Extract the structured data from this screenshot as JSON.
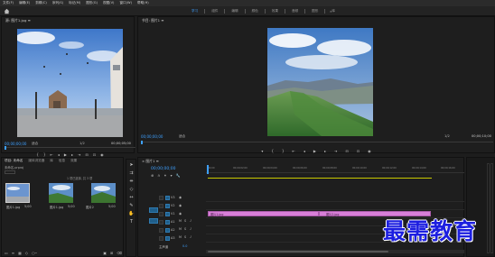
{
  "menu": {
    "items": [
      "文件(F)",
      "编辑(E)",
      "剪辑(C)",
      "序列(S)",
      "标记(M)",
      "图形(G)",
      "视图(V)",
      "窗口(W)",
      "帮助(H)"
    ]
  },
  "workspaces": {
    "tabs": [
      "学习",
      "组件",
      "编辑",
      "颜色",
      "效果",
      "音频",
      "图形",
      "库"
    ],
    "active_index": 0,
    "more_label": "»"
  },
  "source_monitor": {
    "title": "源: 图片1.jpg ≡",
    "timecode_in": "00;00;00;00",
    "fit_label": "适合",
    "fraction": "1/2",
    "timecode_out": "00;00;05;00"
  },
  "program_monitor": {
    "title": "节目: 图片1 ≡",
    "timecode_in": "00;00;00;00",
    "fit_label": "适合",
    "fraction": "1/2",
    "timecode_out": "00;00;10;00"
  },
  "project_panel": {
    "tabs": [
      "项目: 未命名",
      "媒体浏览器",
      "库",
      "信息",
      "效果"
    ],
    "active_tab": 0,
    "file_name": "未命名.prproj",
    "item_count": "1 项已选择, 共 3 项",
    "items": [
      {
        "label": "图片1.jpg",
        "duration": "5;00"
      },
      {
        "label": "图片1.jpg",
        "duration": "5;00"
      },
      {
        "label": "图片2",
        "duration": "5;00"
      }
    ]
  },
  "timeline": {
    "title": "× 图片1 ≡",
    "timecode": "00;00;00;00",
    "ruler_ticks": [
      "00;00",
      "00;00;02;00",
      "00;00;04;00",
      "00;00;06;00",
      "00;00;08;00",
      "00;00;10;00",
      "00;00;12;00",
      "00;00;14;00",
      "00;00;16;00"
    ],
    "tracks": [
      "V3",
      "V2",
      "V1",
      "A1",
      "A2",
      "A3",
      "主声道"
    ],
    "master_value": "0.0",
    "clips": [
      {
        "label": "图片1.jpg",
        "track": "V1"
      },
      {
        "label": "图片2.jpg",
        "track": "V1"
      }
    ]
  },
  "watermark": "最需教育",
  "colors": {
    "accent_blue": "#3ea0ff",
    "clip_pink": "#d87fd8",
    "work_area_yellow": "#c8c800",
    "watermark_blue": "#1d1fe0"
  }
}
